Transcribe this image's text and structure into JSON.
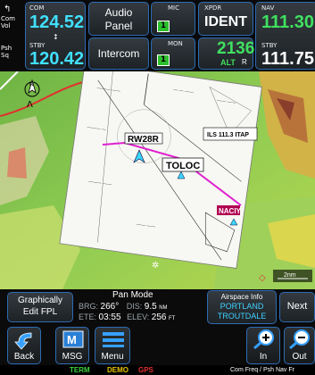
{
  "com": {
    "side_label_top": "Com\nVol",
    "side_label_bottom": "Psh\nSq",
    "active_label": "COM",
    "active_freq": "124.52",
    "standby_label": "STBY",
    "standby_freq": "120.42"
  },
  "audio": {
    "label_line1": "Audio",
    "label_line2": "Panel",
    "intercom_label": "Intercom"
  },
  "mic": {
    "label": "MIC",
    "value": "1",
    "mon_label": "MON",
    "mon_value": "1"
  },
  "xpdr": {
    "label": "XPDR",
    "ident_label": "IDENT",
    "code": "2136",
    "mode": "ALT",
    "mode_suffix": "R"
  },
  "nav": {
    "label": "NAV",
    "active_freq": "111.30",
    "standby_label": "STBY",
    "standby_freq": "111.75"
  },
  "map": {
    "airport_label": "RW28R",
    "fix_label": "TOLOC",
    "fix2_label": "NACIY",
    "scale_label": "2nm",
    "ils_label": "ILS 111.3 ITAP",
    "colors": {
      "terrain_green": "#7ec64a",
      "terrain_yellow": "#e8d54b",
      "terrain_red": "#c8553a",
      "chart_white": "#f7f7f3"
    }
  },
  "status": {
    "graphically_edit_line1": "Graphically",
    "graphically_edit_line2": "Edit FPL",
    "pan_mode": "Pan Mode",
    "brg_label": "BRG:",
    "brg_value": "266°",
    "dis_label": "DIS:",
    "dis_value": "9.5",
    "dis_unit": "NM",
    "ete_label": "ETE:",
    "ete_value": "03:55",
    "elev_label": "ELEV:",
    "elev_value": "256",
    "elev_unit": "FT",
    "airspace_label": "Airspace Info",
    "airspace_line1": "PORTLAND",
    "airspace_line2": "TROUTDALE",
    "next_label": "Next"
  },
  "bottom": {
    "back_label": "Back",
    "msg_label": "MSG",
    "menu_label": "Menu",
    "zoom_in_label": "In",
    "zoom_out_label": "Out"
  },
  "footer": {
    "term": "TERM",
    "demo": "DEMO",
    "gps": "GPS",
    "hint": "Com Freq / Psh Nav Fr"
  }
}
